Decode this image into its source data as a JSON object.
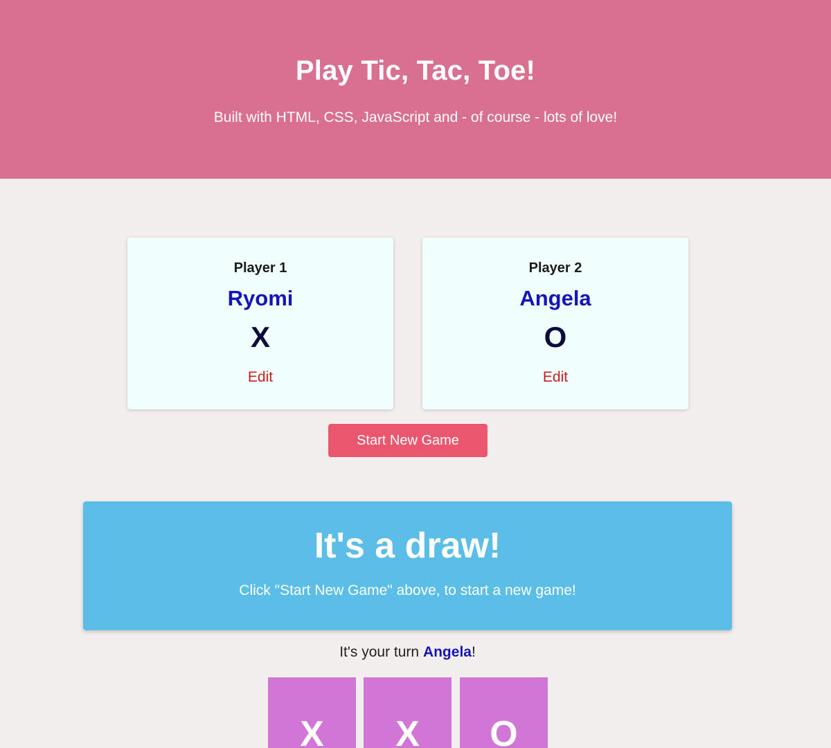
{
  "header": {
    "title": "Play Tic, Tac, Toe!",
    "subtitle": "Built with HTML, CSS, JavaScript and - of course - lots of love!"
  },
  "players": [
    {
      "label": "Player 1",
      "name": "Ryomi",
      "symbol": "X",
      "edit_label": "Edit"
    },
    {
      "label": "Player 2",
      "name": "Angela",
      "symbol": "O",
      "edit_label": "Edit"
    }
  ],
  "start_button": {
    "label": "Start New Game"
  },
  "result": {
    "title": "It's a draw!",
    "message": "Click \"Start New Game\" above, to start a new game!"
  },
  "turn": {
    "prefix": "It's your turn ",
    "player_name": "Angela",
    "suffix": "!"
  },
  "board": {
    "row1": [
      "X",
      "X",
      "O"
    ]
  },
  "colors": {
    "header_bg": "#da7090",
    "page_bg": "#f4efef",
    "card_bg": "#f1fffd",
    "player_name": "#1414b8",
    "edit_link": "#c81e1e",
    "start_button_bg": "#e9566e",
    "result_bg": "#5abee7",
    "board_cell_bg": "#d175d6"
  }
}
